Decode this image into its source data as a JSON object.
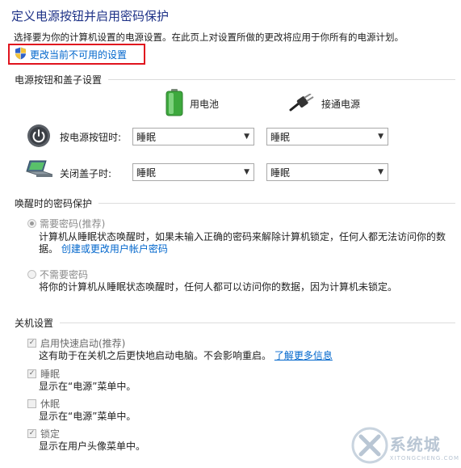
{
  "page": {
    "title": "定义电源按钮并启用密码保护",
    "description": "选择要为你的计算机设置的电源设置。在此页上对设置所做的更改将应用于你所有的电源计划。",
    "change_link": "更改当前不可用的设置"
  },
  "power_section": {
    "heading": "电源按钮和盖子设置",
    "battery_label": "用电池",
    "plugged_label": "接通电源",
    "rows": [
      {
        "label": "按电源按钮时:",
        "battery": "睡眠",
        "plugged": "睡眠"
      },
      {
        "label": "关闭盖子时:",
        "battery": "睡眠",
        "plugged": "睡眠"
      }
    ]
  },
  "password_section": {
    "heading": "唤醒时的密码保护",
    "require_label": "需要密码(推荐)",
    "require_desc_1": "计算机从睡眠状态唤醒时，如果未输入正确的密码来解除计算机锁定，任何人都无法访问你的数",
    "require_desc_2": "据。",
    "require_link": "创建或更改用户帐户密码",
    "no_require_label": "不需要密码",
    "no_require_desc": "将你的计算机从睡眠状态唤醒时，任何人都可以访问你的数据，因为计算机未锁定。"
  },
  "shutdown_section": {
    "heading": "关机设置",
    "items": [
      {
        "label": "启用快速启动(推荐)",
        "checked": true,
        "desc": "这有助于在关机之后更快地启动电脑。不会影响重启。",
        "link": "了解更多信息"
      },
      {
        "label": "睡眠",
        "checked": true,
        "desc": "显示在“电源”菜单中。",
        "link": ""
      },
      {
        "label": "休眠",
        "checked": false,
        "desc": "显示在“电源”菜单中。",
        "link": ""
      },
      {
        "label": "锁定",
        "checked": true,
        "desc": "显示在用户头像菜单中。",
        "link": ""
      }
    ]
  },
  "watermark": {
    "main": "系统城",
    "sub": "XITONGCHENG.COM"
  },
  "colors": {
    "title": "#1e3287",
    "link": "#0066cc",
    "highlight": "#e0141e"
  }
}
